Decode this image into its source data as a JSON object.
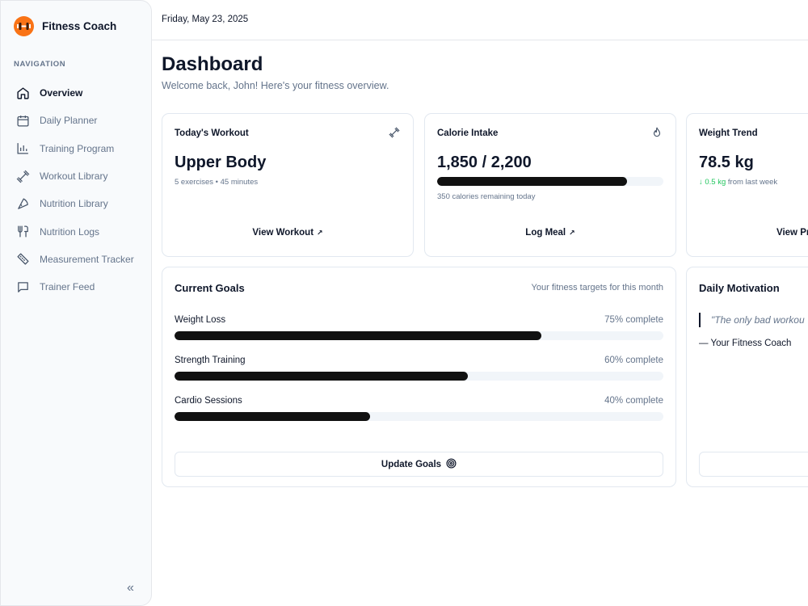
{
  "app": {
    "name": "Fitness Coach"
  },
  "sidebar": {
    "heading": "NAVIGATION",
    "items": [
      {
        "label": "Overview",
        "icon": "home-icon",
        "active": true
      },
      {
        "label": "Daily Planner",
        "icon": "calendar-icon"
      },
      {
        "label": "Training Program",
        "icon": "bar-chart-icon"
      },
      {
        "label": "Workout Library",
        "icon": "dumbbell-icon"
      },
      {
        "label": "Nutrition Library",
        "icon": "pizza-icon"
      },
      {
        "label": "Nutrition Logs",
        "icon": "utensils-icon"
      },
      {
        "label": "Measurement Tracker",
        "icon": "ruler-icon"
      },
      {
        "label": "Trainer Feed",
        "icon": "message-icon"
      }
    ],
    "collapse_label": "«"
  },
  "header": {
    "date": "Friday, May 23, 2025"
  },
  "page": {
    "title": "Dashboard",
    "subtitle": "Welcome back, John! Here's your fitness overview."
  },
  "cards": {
    "workout": {
      "label": "Today's Workout",
      "title": "Upper Body",
      "meta": "5 exercises • 45 minutes",
      "link": "View Workout",
      "link_arrow": "↗"
    },
    "calories": {
      "label": "Calorie Intake",
      "value": "1,850 / 2,200",
      "progress": 0.84,
      "meta": "350 calories remaining today",
      "link": "Log Meal",
      "link_arrow": "↗"
    },
    "weight": {
      "label": "Weight Trend",
      "value": "78.5 kg",
      "delta": "↓ 0.5 kg",
      "delta_suffix": "from last week",
      "link": "View Pr"
    }
  },
  "goals": {
    "title": "Current Goals",
    "note": "Your fitness targets for this month",
    "items": [
      {
        "name": "Weight Loss",
        "pct_label": "75% complete",
        "progress": 0.75
      },
      {
        "name": "Strength Training",
        "pct_label": "60% complete",
        "progress": 0.6
      },
      {
        "name": "Cardio Sessions",
        "pct_label": "40% complete",
        "progress": 0.4
      }
    ],
    "button": "Update Goals"
  },
  "motivation": {
    "title": "Daily Motivation",
    "quote": "\"The only bad workou",
    "author": "— Your Fitness Coach"
  },
  "colors": {
    "brand": "#f97316",
    "positive": "#22c55e",
    "bar": "#111111",
    "track": "#f1f5f9"
  }
}
